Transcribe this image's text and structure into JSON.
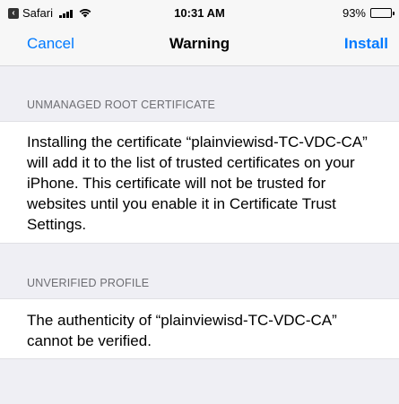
{
  "status_bar": {
    "back_app": "Safari",
    "time": "10:31 AM",
    "battery": "93%",
    "battery_level": 0.93
  },
  "nav": {
    "cancel_label": "Cancel",
    "title": "Warning",
    "install_label": "Install",
    "accent_color": "#007aff"
  },
  "sections": [
    {
      "header": "UNMANAGED ROOT CERTIFICATE",
      "body": "Installing the certificate “plainviewisd-TC-VDC-CA” will add it to the list of trusted certificates on your iPhone. This certificate will not be trusted for websites until you enable it in Certificate Trust Settings."
    },
    {
      "header": "UNVERIFIED PROFILE",
      "body": "The authenticity of “plainviewisd-TC-VDC-CA” cannot be verified."
    }
  ],
  "icons": [
    "back-app-icon",
    "signal-icon",
    "wifi-icon",
    "battery-icon"
  ]
}
